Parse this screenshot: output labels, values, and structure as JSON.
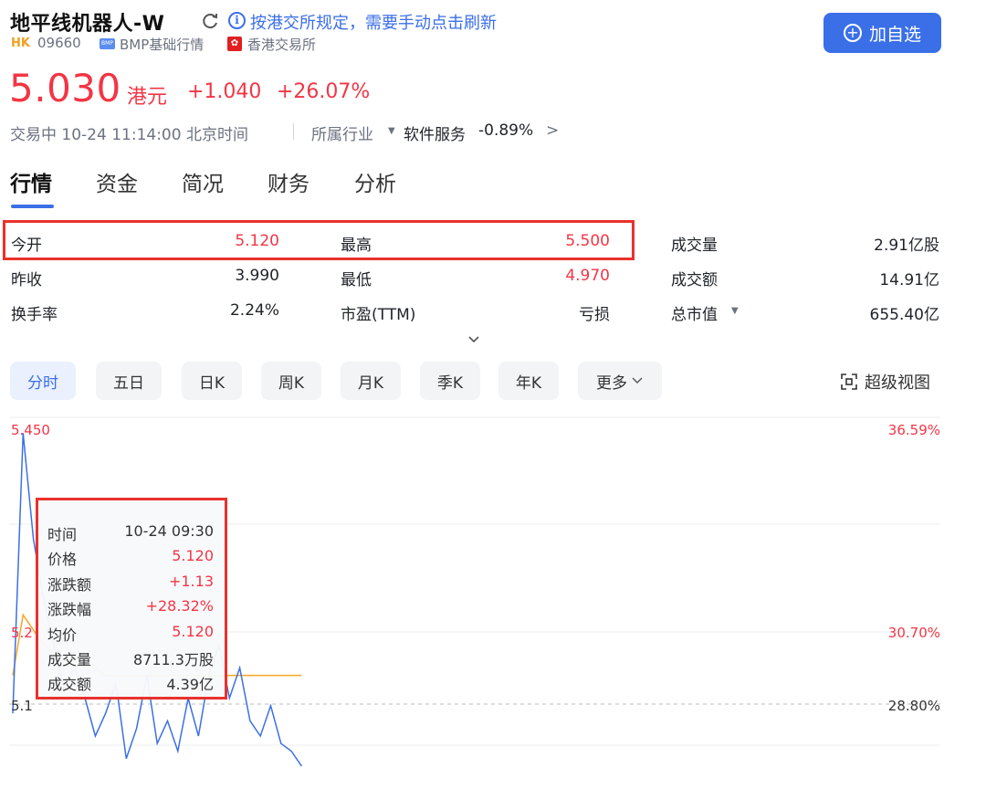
{
  "header": {
    "stock_name": "地平线机器人-W",
    "notice_icon": "i",
    "notice": "按港交所规定，需要手动点击刷新",
    "market_tag": "HK",
    "code": "09660",
    "bmp_icon_text": "BMP",
    "bmp_label": "BMP基础行情",
    "hkex_icon_text": "✿",
    "exchange": "香港交易所",
    "add_watch_icon": "+",
    "add_watch": "加自选"
  },
  "quote": {
    "price": "5.030",
    "currency": "港元",
    "change": "+1.040",
    "change_pct": "+26.07%"
  },
  "status": {
    "text": "交易中 10-24 11:14:00 北京时间",
    "industry_label": "所属行业",
    "industry_caret": "▼",
    "industry_name": "软件服务",
    "industry_change": "-0.89%",
    "industry_arrow": ">"
  },
  "tabs": [
    "行情",
    "资金",
    "简况",
    "财务",
    "分析"
  ],
  "stats": {
    "open_label": "今开",
    "open": "5.120",
    "high_label": "最高",
    "high": "5.500",
    "volume_label": "成交量",
    "volume": "2.91亿股",
    "prev_close_label": "昨收",
    "prev_close": "3.990",
    "low_label": "最低",
    "low": "4.970",
    "turnover_label": "成交额",
    "turnover": "14.91亿",
    "turnover_rate_label": "换手率",
    "turnover_rate": "2.24%",
    "pe_label": "市盈(TTM)",
    "pe": "亏损",
    "market_cap_label": "总市值",
    "market_cap_caret": "▼",
    "market_cap": "655.40亿"
  },
  "periods": [
    "分时",
    "五日",
    "日K",
    "周K",
    "月K",
    "季K",
    "年K",
    "更多"
  ],
  "super_view": "超级视图",
  "chart_data": {
    "type": "line",
    "left_axis_labels": [
      "5.450",
      "5.2",
      "5.1"
    ],
    "right_axis_labels": [
      "36.59%",
      "30.70%",
      "28.80%"
    ],
    "series": [
      {
        "values": [
          5.07,
          5.44,
          5.3,
          5.22,
          5.16,
          5.1,
          5.13,
          5.09,
          5.04,
          5.07,
          5.11,
          5.01,
          5.05,
          5.12,
          5.03,
          5.06,
          5.02,
          5.09,
          5.04,
          5.12,
          5.16,
          5.09,
          5.13,
          5.06,
          5.04,
          5.08,
          5.03,
          5.02,
          5.0
        ]
      },
      {
        "values": [
          5.12,
          5.2,
          5.18,
          5.16,
          5.15,
          5.14,
          5.14,
          5.13,
          5.13,
          5.12,
          5.12,
          5.12,
          5.12,
          5.12,
          5.12,
          5.12,
          5.12,
          5.12,
          5.12,
          5.12,
          5.12,
          5.12,
          5.12,
          5.12,
          5.12,
          5.12,
          5.12,
          5.12,
          5.12
        ]
      }
    ]
  },
  "tooltip": {
    "time_label": "时间",
    "time": "10-24 09:30",
    "price_label": "价格",
    "price": "5.120",
    "change_label": "涨跌额",
    "change": "+1.13",
    "change_pct_label": "涨跌幅",
    "change_pct": "+28.32%",
    "avg_label": "均价",
    "avg": "5.120",
    "volume_label": "成交量",
    "volume": "8711.3万股",
    "amount_label": "成交额",
    "amount": "4.39亿"
  },
  "colors": {
    "up": "#f23645",
    "accent": "#3b6fe8",
    "highlight": "#e8322c"
  }
}
